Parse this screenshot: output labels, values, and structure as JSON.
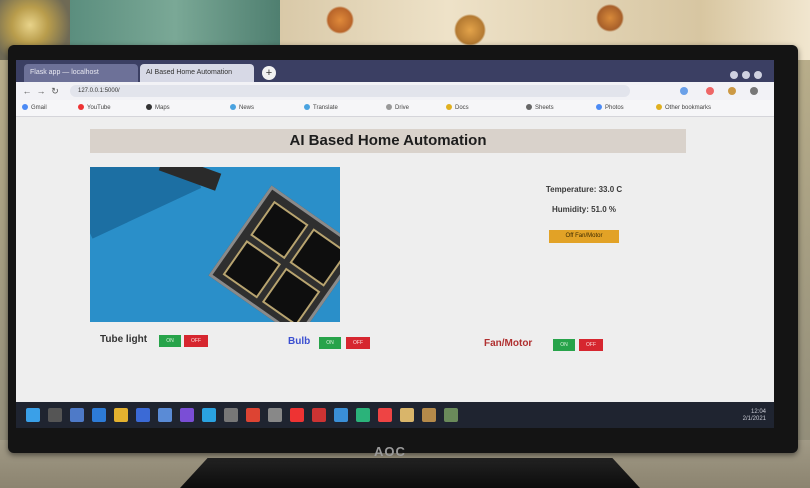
{
  "browser": {
    "tabs": [
      {
        "label": "Flask app — localhost"
      },
      {
        "label": "AI Based Home Automation"
      }
    ],
    "new_tab_label": "+",
    "url": "127.0.0.1:5000/",
    "bookmarks": [
      "Gmail",
      "YouTube",
      "Maps",
      "News",
      "Translate",
      "Drive",
      "Docs",
      "Sheets",
      "Photos",
      "Other bookmarks"
    ]
  },
  "page": {
    "title": "AI Based Home Automation",
    "temperature": "Temperature: 33.0 C",
    "humidity": "Humidity: 51.0 %",
    "capture_button": "Off Fan/Motor",
    "devices": [
      {
        "name": "Tube light",
        "on": "ON",
        "off": "OFF",
        "color": "#333333"
      },
      {
        "name": "Bulb",
        "on": "ON",
        "off": "OFF",
        "color": "#3b4fd1"
      },
      {
        "name": "Fan/Motor",
        "on": "ON",
        "off": "OFF",
        "color": "#b03030"
      }
    ]
  },
  "monitor_brand": "AOC",
  "taskbar": {
    "time": "12:04",
    "date": "2/1/2021"
  },
  "colors": {
    "header_bg": "#d9d2cb",
    "camera_bg": "#2a8fc9",
    "on_button": "#27a34a",
    "off_button": "#d6262f",
    "accent_button": "#e2a226"
  }
}
